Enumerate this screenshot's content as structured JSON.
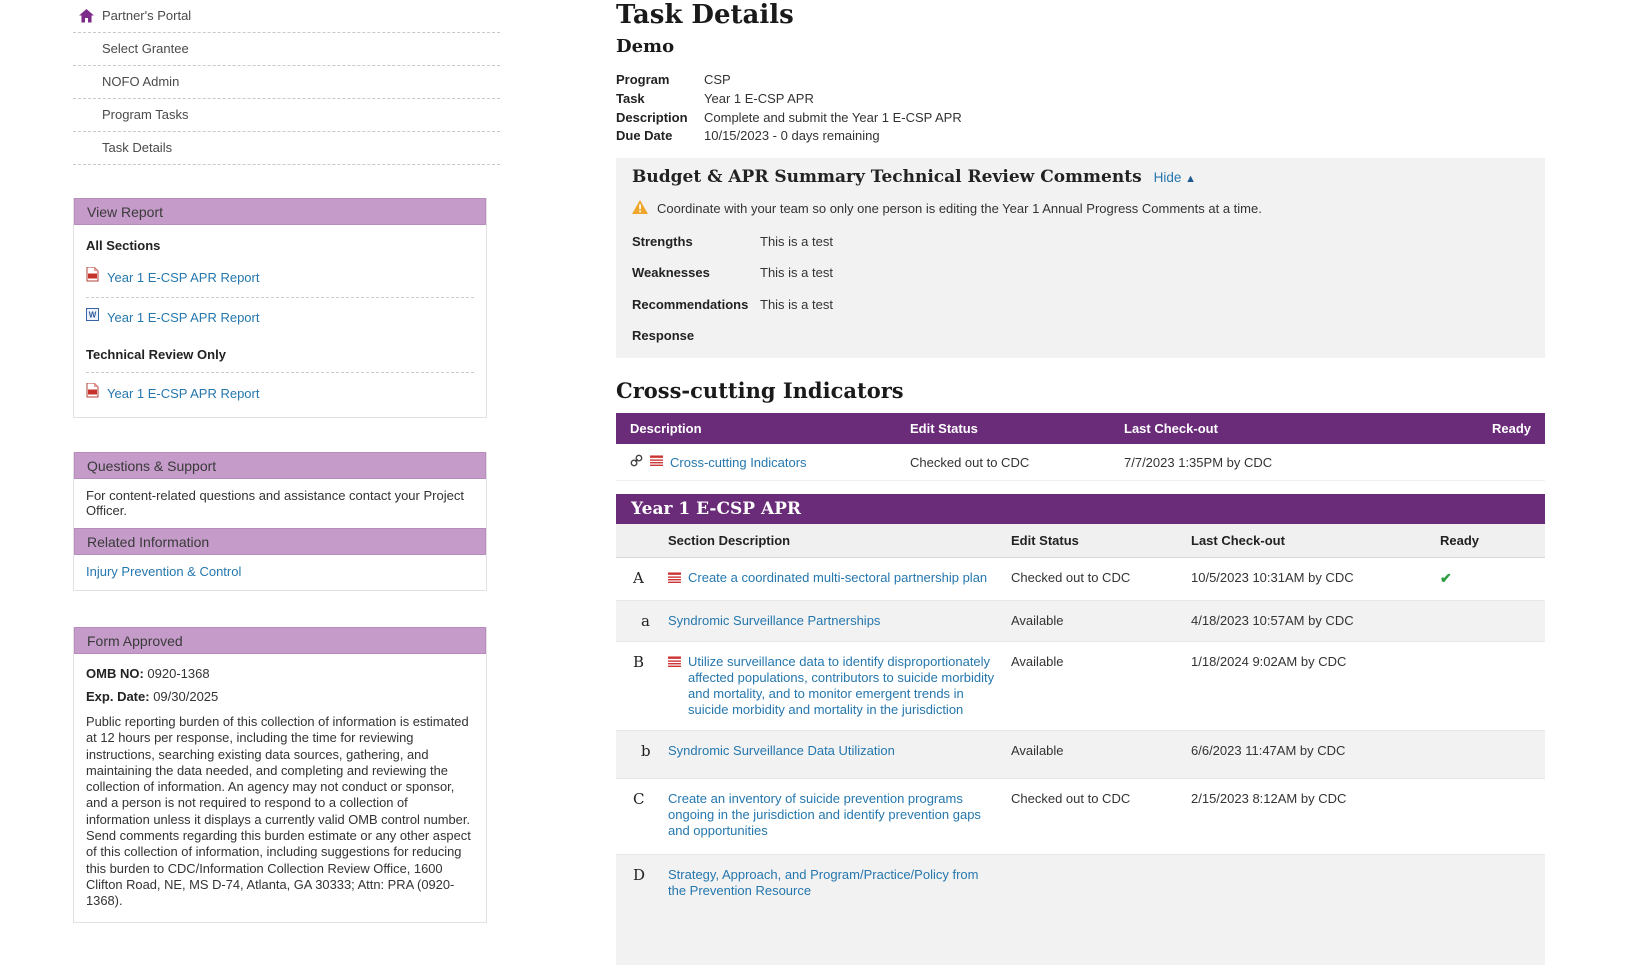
{
  "colors": {
    "header_purple_light": "#c49bc9",
    "table_purple": "#6a2b78",
    "link_blue": "#2577ae",
    "ready_green": "#2e9e44",
    "warning_orange": "#f0a52b",
    "doc_icon_red": "#cc3333"
  },
  "icons": {
    "hide_arrow": "▲",
    "check": "✔"
  },
  "sidebar": {
    "nav": [
      {
        "label": "Partner's Portal"
      },
      {
        "label": "Select Grantee"
      },
      {
        "label": "NOFO Admin"
      },
      {
        "label": "Program Tasks"
      },
      {
        "label": "Task Details"
      }
    ],
    "view_report": {
      "title": "View Report",
      "all_sections_heading": "All Sections",
      "pdf_link_1": "Year 1 E-CSP APR Report",
      "word_link": "Year 1 E-CSP APR Report",
      "technical_heading": "Technical Review Only",
      "pdf_link_2": "Year 1 E-CSP APR Report"
    },
    "questions_support": {
      "title": "Questions & Support",
      "body": "For content-related questions and assistance contact your Project Officer."
    },
    "related_information": {
      "title": "Related Information",
      "link": "Injury Prevention & Control"
    },
    "form_approved": {
      "title": "Form Approved",
      "omb_label": "OMB NO:",
      "omb_value": "0920-1368",
      "exp_label": "Exp. Date:",
      "exp_value": "09/30/2025",
      "body": "Public reporting burden of this collection of information is estimated at 12 hours per response, including the time for reviewing instructions, searching existing data sources, gathering, and maintaining the data needed, and completing and reviewing the collection of information. An agency may not conduct or sponsor, and a person is not required to respond to a collection of information unless it displays a currently valid OMB control number. Send comments regarding this burden estimate or any other aspect of this collection of information, including suggestions for reducing this burden to CDC/Information Collection Review Office, 1600 Clifton Road, NE, MS D-74, Atlanta, GA 30333; Attn: PRA (0920-1368)."
    }
  },
  "main": {
    "title": "Task Details",
    "subtitle": "Demo",
    "details": [
      {
        "label": "Program",
        "value": "CSP"
      },
      {
        "label": "Task",
        "value": "Year 1 E-CSP APR"
      },
      {
        "label": "Description",
        "value": "Complete and submit the Year 1 E-CSP APR"
      },
      {
        "label": "Due Date",
        "value": "10/15/2023 - 0 days remaining"
      }
    ],
    "review_comments": {
      "title": "Budget & APR Summary Technical Review Comments",
      "hide_label": "Hide",
      "warning": "Coordinate with your team so only one person is editing the Year 1 Annual Progress Comments at a time.",
      "rows": [
        {
          "label": "Strengths",
          "value": "This is a test"
        },
        {
          "label": "Weaknesses",
          "value": "This is a test"
        },
        {
          "label": "Recommendations",
          "value": "This is a test"
        },
        {
          "label": "Response",
          "value": ""
        }
      ]
    },
    "cross_cutting": {
      "heading": "Cross-cutting Indicators",
      "columns": [
        "Description",
        "Edit Status",
        "Last Check-out",
        "Ready"
      ],
      "row": {
        "description": "Cross-cutting Indicators",
        "edit_status": "Checked out to CDC",
        "last_checkout": "7/7/2023 1:35PM by CDC"
      }
    },
    "apr_table": {
      "banner": "Year 1 E-CSP APR",
      "columns": [
        "Section Description",
        "Edit Status",
        "Last Check-out",
        "Ready"
      ],
      "rows": [
        {
          "letter": "A",
          "description": "Create a coordinated multi-sectoral partnership plan",
          "edit_status": "Checked out to CDC",
          "last_checkout": "10/5/2023 10:31AM by CDC"
        },
        {
          "letter": "a",
          "description": "Syndromic Surveillance Partnerships",
          "edit_status": "Available",
          "last_checkout": "4/18/2023 10:57AM by CDC"
        },
        {
          "letter": "B",
          "description": "Utilize surveillance data to identify disproportionately affected populations, contributors to suicide morbidity and mortality, and to monitor emergent trends in suicide morbidity and mortality in the jurisdiction",
          "edit_status": "Available",
          "last_checkout": "1/18/2024 9:02AM by CDC"
        },
        {
          "letter": "b",
          "description": "Syndromic Surveillance Data Utilization",
          "edit_status": "Available",
          "last_checkout": "6/6/2023 11:47AM by CDC"
        },
        {
          "letter": "C",
          "description": "Create an inventory of suicide prevention programs ongoing in the jurisdiction and identify prevention gaps and opportunities",
          "edit_status": "Checked out to CDC",
          "last_checkout": "2/15/2023 8:12AM by CDC"
        },
        {
          "letter": "D",
          "description": "Strategy, Approach, and Program/Practice/Policy from the Prevention Resource",
          "edit_status": "",
          "last_checkout": ""
        }
      ]
    }
  }
}
